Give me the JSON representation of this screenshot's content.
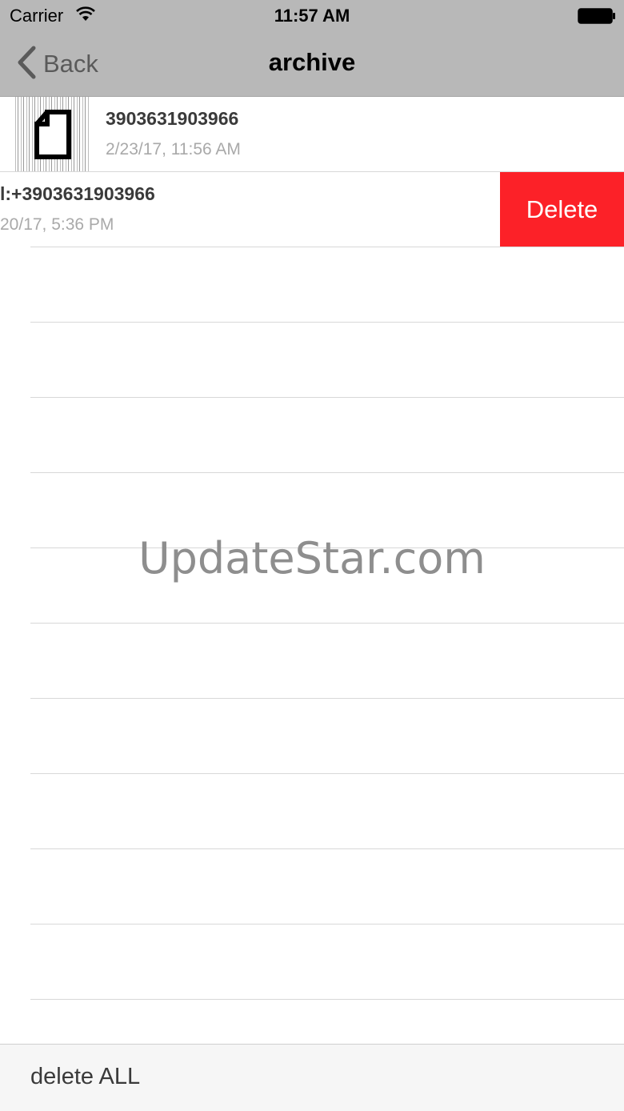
{
  "status_bar": {
    "carrier": "Carrier",
    "time": "11:57 AM"
  },
  "nav": {
    "back_label": "Back",
    "title": "archive"
  },
  "rows": [
    {
      "title": "3903631903966",
      "subtitle": "2/23/17, 11:56 AM"
    },
    {
      "title": "l:+3903631903966",
      "subtitle": "20/17, 5:36 PM"
    }
  ],
  "delete_action": {
    "label": "Delete",
    "color": "#fc2128"
  },
  "watermark": "UpdateStar.com",
  "toolbar": {
    "delete_all_label": "delete ALL"
  },
  "colors": {
    "bar_background": "#b8b8b8",
    "toolbar_background": "#f6f6f6"
  }
}
